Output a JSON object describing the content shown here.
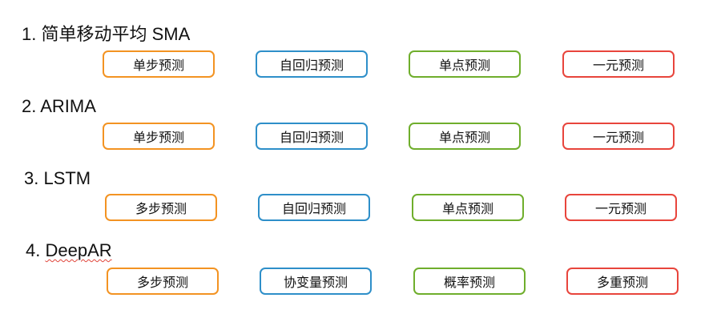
{
  "colors": {
    "orange": "#f39322",
    "blue": "#2e8fc9",
    "green": "#6fae2c",
    "red": "#e8453c",
    "text": "#111111"
  },
  "sections": [
    {
      "title": "1. 简单移动平均  SMA",
      "tags": [
        "单步预测",
        "自回归预测",
        "单点预测",
        "一元预测"
      ]
    },
    {
      "title": "2. ARIMA",
      "tags": [
        "单步预测",
        "自回归预测",
        "单点预测",
        "一元预测"
      ]
    },
    {
      "title": "3. LSTM",
      "tags": [
        "多步预测",
        "自回归预测",
        "单点预测",
        "一元预测"
      ]
    },
    {
      "title": "4. DeepAR",
      "tags": [
        "多步预测",
        "协变量预测",
        "概率预测",
        "多重预测"
      ]
    }
  ]
}
